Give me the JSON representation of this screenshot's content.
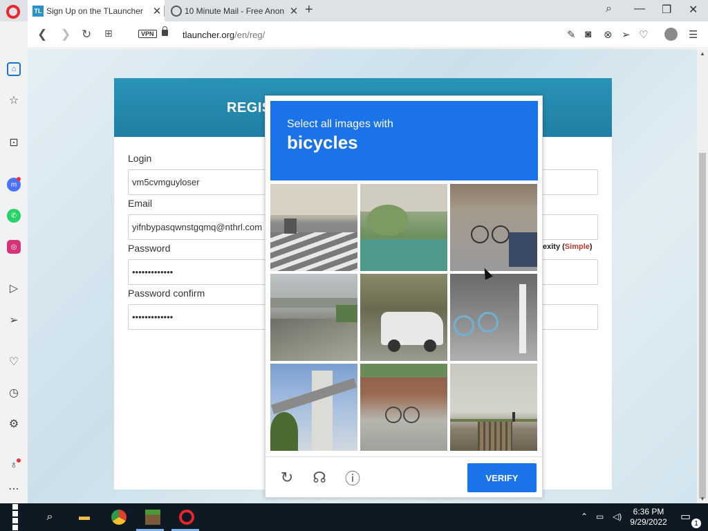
{
  "browser": {
    "tabs": [
      {
        "title": "Sign Up on the TLauncher",
        "favicon": "TL",
        "active": true
      },
      {
        "title": "10 Minute Mail - Free Anon",
        "active": false
      }
    ],
    "new_tab": "+",
    "vpn_badge": "VPN",
    "url_host": "tlauncher.org",
    "url_path": "/en/reg/"
  },
  "page": {
    "heading": "REGIS",
    "fields": [
      {
        "label": "Login",
        "value": "vm5cvmguyloser"
      },
      {
        "label": "Email",
        "value": "yifnbypasqwnstgqmq@nthrl.com"
      },
      {
        "label": "Password",
        "value": "•••••••••••••"
      },
      {
        "label": "Password confirm",
        "value": "•••••••••••••"
      }
    ],
    "password_hint_prefix": "exity (",
    "password_hint_value": "Simple",
    "password_hint_suffix": ")"
  },
  "captcha": {
    "instruction": "Select all images with",
    "target": "bicycles",
    "verify_label": "VERIFY",
    "tiles": [
      {
        "scene": "crosswalk street"
      },
      {
        "scene": "garden path"
      },
      {
        "scene": "parked bicycles on sidewalk"
      },
      {
        "scene": "highway road"
      },
      {
        "scene": "white minivan"
      },
      {
        "scene": "bike share rack"
      },
      {
        "scene": "bridge with palm trees"
      },
      {
        "scene": "bicycle by brick wall"
      },
      {
        "scene": "railway track"
      }
    ]
  },
  "taskbar": {
    "time": "6:36 PM",
    "date": "9/29/2022",
    "notifications": "1"
  },
  "colors": {
    "captcha_blue": "#1a73e8",
    "header_teal": "#2a93b8",
    "password_weak": "#c0392b"
  }
}
